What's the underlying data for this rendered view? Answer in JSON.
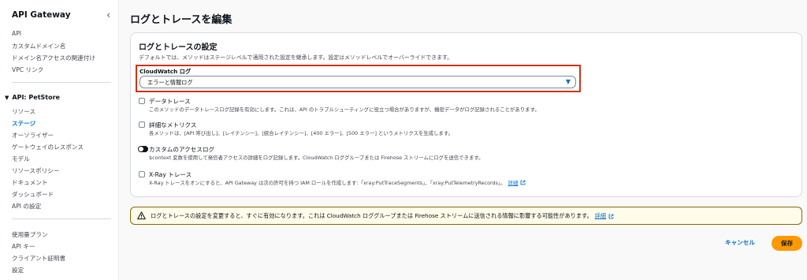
{
  "sidebar": {
    "title": "API Gateway",
    "collapse_icon": "‹",
    "top_links": [
      "API",
      "カスタムドメイン名",
      "ドメイン名アクセスの関連付け",
      "VPC リンク"
    ],
    "section": {
      "caret": "▼",
      "title": "API: PetStore",
      "items": [
        "リソース",
        "ステージ",
        "オーソライザー",
        "ゲートウェイのレスポンス",
        "モデル",
        "リソースポリシー",
        "ドキュメント",
        "ダッシュボード",
        "API の設定"
      ]
    },
    "bottom_links": [
      "使用量プラン",
      "API キー",
      "クライアント証明書",
      "設定"
    ]
  },
  "page": {
    "title": "ログとトレースを編集"
  },
  "panel": {
    "title": "ログとトレースの設定",
    "description": "デフォルトでは、メソッドはステージレベルで適用された設定を継承します。設定はメソッドレベルでオーバーライドできます。",
    "cloudwatch": {
      "label": "CloudWatch ログ",
      "value": "エラーと情報ログ",
      "caret": "▼"
    },
    "data_trace": {
      "label": "データトレース",
      "description": "このメソッドのデータトレースログ記録を有効にします。これは、API のトラブルシューティングに役立つ場合がありますが、機密データがログ記録されることがあります。"
    },
    "detailed_metrics": {
      "label": "詳細なメトリクス",
      "description": "各メソッドは、[API 呼び出し]、[レイテンシー]、[統合レイテンシー]、[400 エラー]、[500 エラー] というメトリクスを生成します。"
    },
    "access_log": {
      "label": "カスタムのアクセスログ",
      "description": "$context 変数を使用して発信者アクセスの詳細をログ記録します。CloudWatch ロググループまたは Firehose ストリームにログを送信できます。"
    },
    "xray": {
      "label": "X-Ray トレース",
      "description": "X-Ray トレースをオンにすると、API Gateway は次の許可を持つ IAM ロールを作成します:「xray:PutTraceSegments」、「xray:PutTelemetryRecords」。",
      "link": "詳細"
    }
  },
  "alert": {
    "text": "ログとトレースの設定を変更すると、すぐに有効になります。これは CloudWatch ロググループまたは Firehose ストリームに送信される情報に影響する可能性があります。",
    "link": "詳細"
  },
  "actions": {
    "cancel": "キャンセル",
    "save": "保存"
  },
  "colors": {
    "accent": "#0972d3",
    "primary_button": "#ff9900",
    "highlight_border": "#d13212",
    "warning_border": "#8d6605",
    "warning_bg": "#fffce9"
  }
}
